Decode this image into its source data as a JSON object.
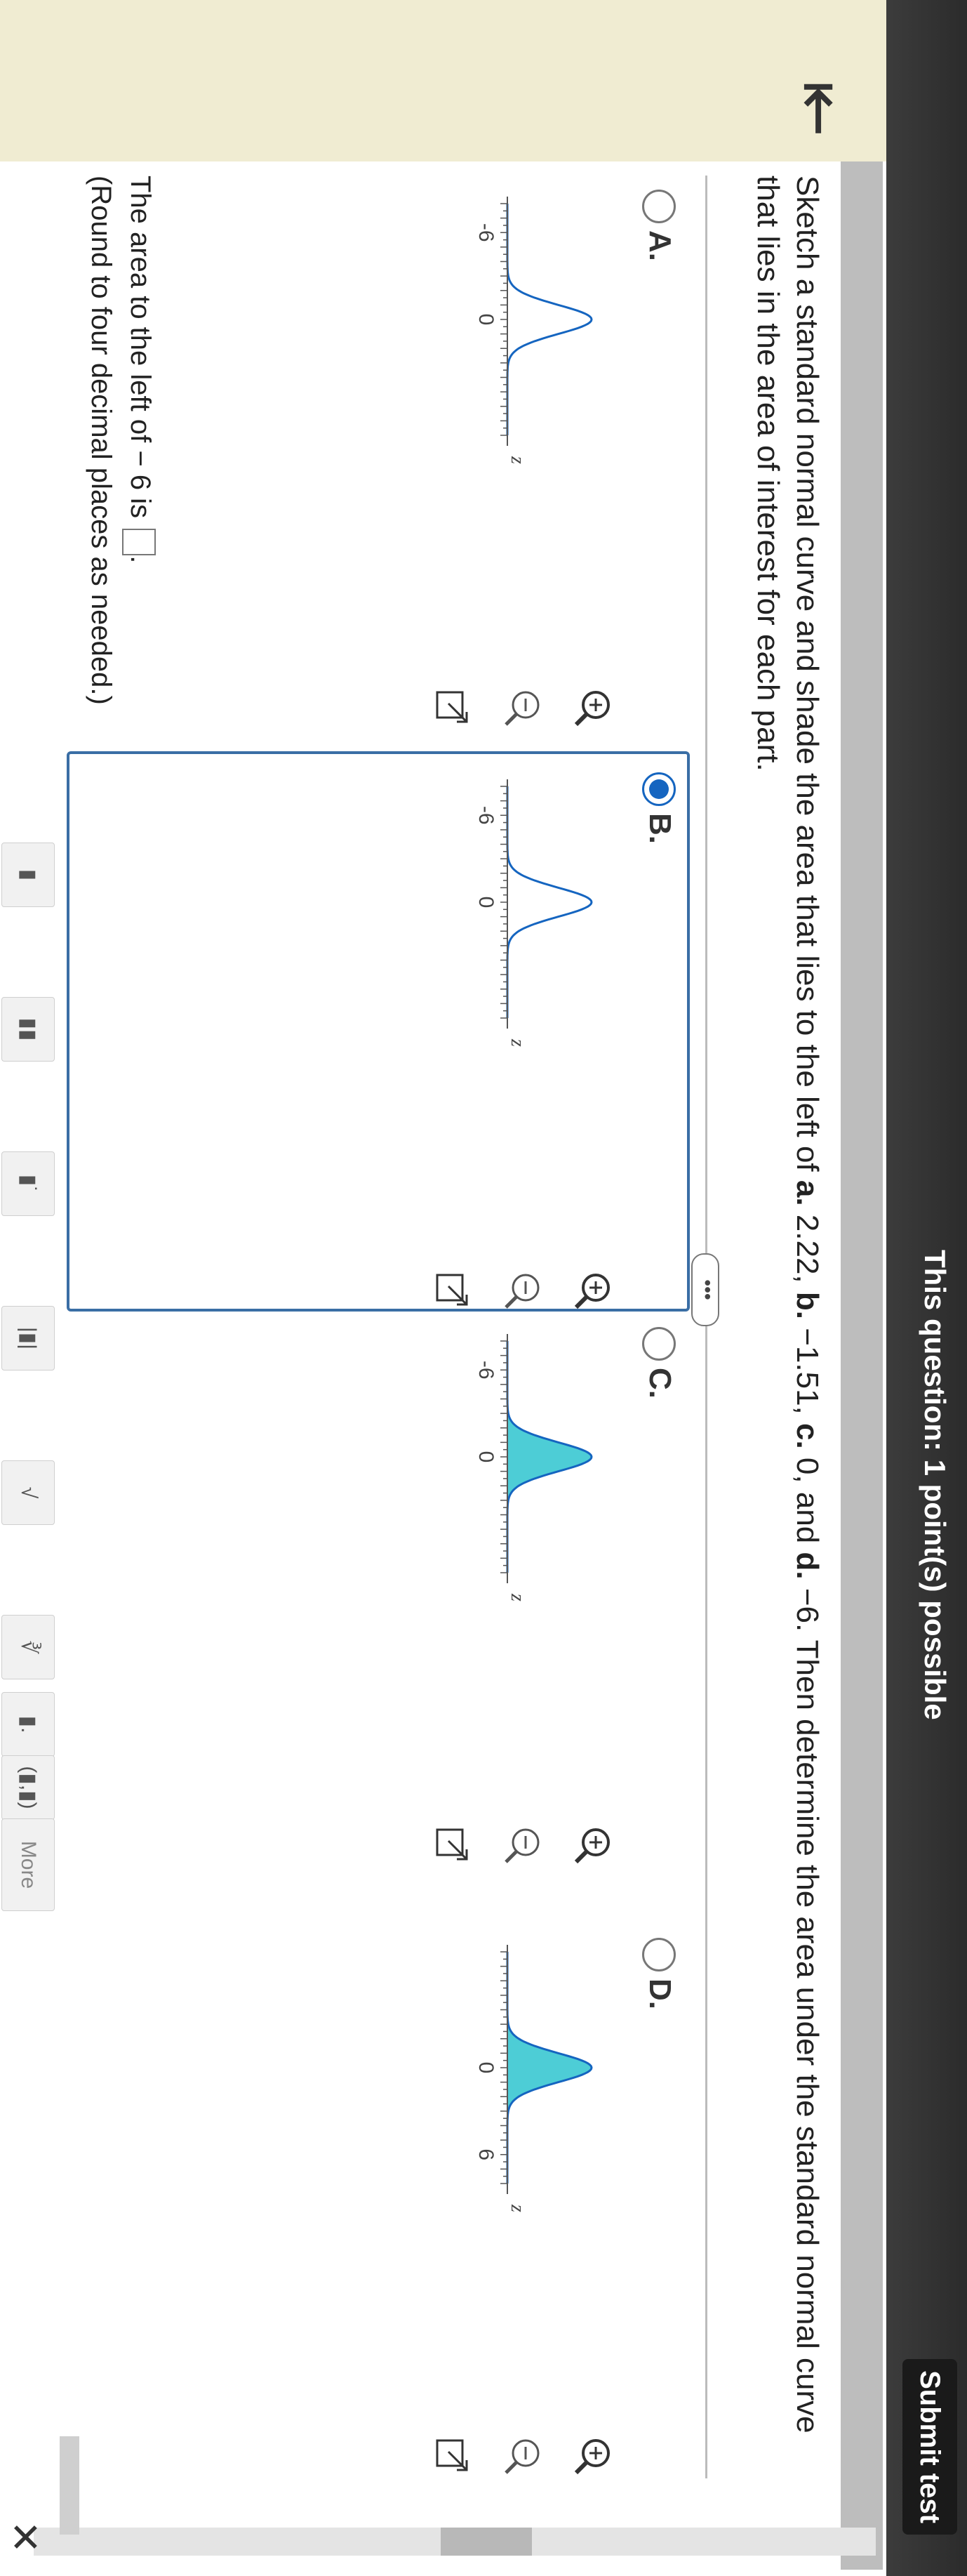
{
  "header": {
    "title": "This question: 1 point(s) possible",
    "submit_label": "Submit test",
    "back_icon": "back-arrow-icon"
  },
  "question": {
    "prefix": "Sketch a standard normal curve and shade the area that lies to the left of ",
    "a_label": "a.",
    "a_value": " 2.22, ",
    "b_label": "b.",
    "b_value": " −1.51, ",
    "c_label": "c.",
    "c_value": " 0, and ",
    "d_label": "d.",
    "d_value": " −6. Then determine the area under the standard normal curve that lies in the area of interest for each part."
  },
  "expand_label": "•••",
  "options": [
    {
      "letter": "A.",
      "tick_left": "-6",
      "tick_right": "0",
      "axis_label": "z",
      "selected": false
    },
    {
      "letter": "B.",
      "tick_left": "-6",
      "tick_right": "0",
      "axis_label": "z",
      "selected": true
    },
    {
      "letter": "C.",
      "tick_left": "-6",
      "tick_right": "0",
      "axis_label": "z",
      "selected": false
    },
    {
      "letter": "D.",
      "tick_left": "0",
      "tick_right": "6",
      "axis_label": "z",
      "selected": false
    }
  ],
  "answer": {
    "prompt": "The area to the left of − 6 is",
    "suffix": ".",
    "note": "(Round to four decimal places as needed.)",
    "value": ""
  },
  "toolbar": {
    "more_label": "More"
  },
  "colors": {
    "shade": "#2ec4cf",
    "curve": "#1565c0",
    "selected_border": "#3a6ea5"
  }
}
